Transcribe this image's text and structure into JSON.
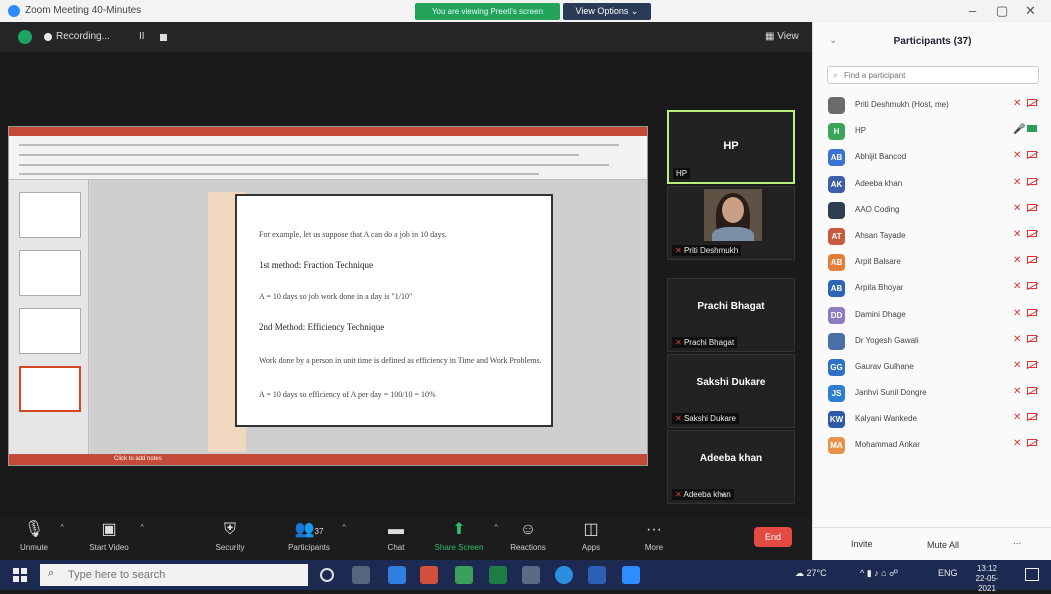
{
  "window": {
    "title": "Zoom Meeting 40-Minutes",
    "share_banner": "You are viewing Preeti's screen",
    "view_options": "View Options",
    "minimize": "–",
    "maximize": "▢",
    "close": "✕"
  },
  "topbar": {
    "recording": "Recording...",
    "pause": "II",
    "view": "View"
  },
  "slide": {
    "lines": [
      "For example, let us suppose that A can do a job in 10 days.",
      "1st method: Fraction Technique",
      "A = 10 days so job work done in a day is \"1/10\"",
      "2nd Method: Efficiency Technique",
      "Work done by a person in unit time is defined as efficiency in Time and Work Problems.",
      "A = 10 days so efficiency of A per day = 100/10 = 10%"
    ],
    "notes": "Click to add notes"
  },
  "tiles": [
    {
      "initials": "HP",
      "name": "HP",
      "muted": false
    },
    {
      "initials": "",
      "name": "Priti Deshmukh",
      "muted": true
    },
    {
      "initials": "Prachi Bhagat",
      "name": "Prachi Bhagat",
      "muted": true
    },
    {
      "initials": "Sakshi Dukare",
      "name": "Sakshi Dukare",
      "muted": true
    },
    {
      "initials": "Adeeba khan",
      "name": "Adeeba khan",
      "muted": true
    }
  ],
  "toolbar": {
    "unmute": "Unmute",
    "start_video": "Start Video",
    "security": "Security",
    "participants": "Participants",
    "participants_count": "37",
    "chat": "Chat",
    "share_screen": "Share Screen",
    "reactions": "Reactions",
    "apps": "Apps",
    "more": "More",
    "end": "End"
  },
  "panel": {
    "title": "Participants (37)",
    "search_placeholder": "Find a participant",
    "invite": "Invite",
    "mute_all": "Mute All",
    "more": "..."
  },
  "participants": [
    {
      "name": "Priti Deshmukh (Host, me)",
      "initials": "",
      "color": "#6b6b6b",
      "mic_on": false,
      "cam_on": false
    },
    {
      "name": "HP",
      "initials": "H",
      "color": "#3aa45a",
      "mic_on": true,
      "cam_on": true
    },
    {
      "name": "Abhijit Bancod",
      "initials": "AB",
      "color": "#3b73d1",
      "mic_on": false,
      "cam_on": false
    },
    {
      "name": "Adeeba khan",
      "initials": "AK",
      "color": "#3b5fa8",
      "mic_on": false,
      "cam_on": false
    },
    {
      "name": "AAO Coding",
      "initials": "",
      "color": "#2c3e50",
      "mic_on": false,
      "cam_on": false
    },
    {
      "name": "Ahsan Tayade",
      "initials": "AT",
      "color": "#c9593f",
      "mic_on": false,
      "cam_on": false
    },
    {
      "name": "Arpit Balsare",
      "initials": "AB",
      "color": "#e27e3a",
      "mic_on": false,
      "cam_on": false
    },
    {
      "name": "Arpita Bhoyar",
      "initials": "AB",
      "color": "#2f63b6",
      "mic_on": false,
      "cam_on": false
    },
    {
      "name": "Damini Dhage",
      "initials": "DD",
      "color": "#8e7cc3",
      "mic_on": false,
      "cam_on": false
    },
    {
      "name": "Dr Yogesh Gawali",
      "initials": "",
      "color": "#4a6fa5",
      "mic_on": false,
      "cam_on": false
    },
    {
      "name": "Gaurav Gulhane",
      "initials": "GG",
      "color": "#2d72c4",
      "mic_on": false,
      "cam_on": false
    },
    {
      "name": "Janhvi Sunil Dongre",
      "initials": "JS",
      "color": "#2f7fd0",
      "mic_on": false,
      "cam_on": false
    },
    {
      "name": "Kalyani Wankede",
      "initials": "KW",
      "color": "#2c5aa8",
      "mic_on": false,
      "cam_on": false
    },
    {
      "name": "Mohammad Ankar",
      "initials": "MA",
      "color": "#e9924b",
      "mic_on": false,
      "cam_on": false
    }
  ],
  "taskbar": {
    "search_placeholder": "Type here to search",
    "temperature": "27°C",
    "language": "ENG",
    "time": "13:12",
    "date": "22-05-2021"
  }
}
